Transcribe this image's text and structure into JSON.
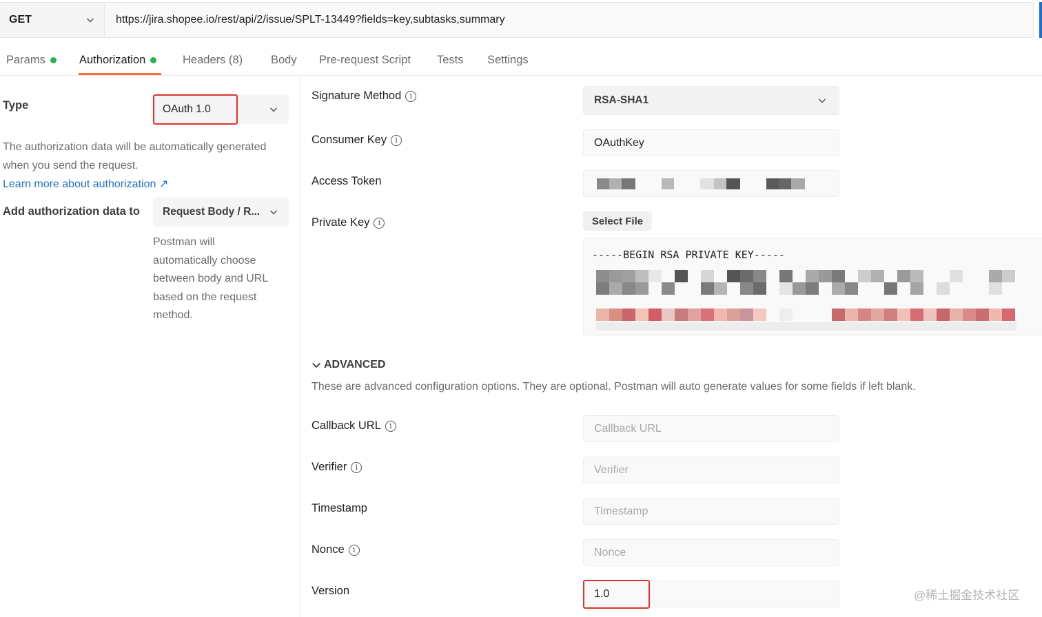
{
  "request": {
    "method": "GET",
    "url": "https://jira.shopee.io/rest/api/2/issue/SPLT-13449?fields=key,subtasks,summary"
  },
  "tabs": [
    {
      "label": "Params",
      "dot": true
    },
    {
      "label": "Authorization",
      "dot": true,
      "active": true
    },
    {
      "label": "Headers (8)"
    },
    {
      "label": "Body"
    },
    {
      "label": "Pre-request Script"
    },
    {
      "label": "Tests"
    },
    {
      "label": "Settings"
    }
  ],
  "auth": {
    "type_label": "Type",
    "type_value": "OAuth 1.0",
    "description_line1": "The authorization data will be automatically generated",
    "description_line2": "when you send the request.",
    "learn_more": "Learn more about authorization ↗",
    "add_to_label": "Add authorization data to",
    "add_to_value": "Request Body / R...",
    "add_to_help": [
      "Postman will",
      "automatically choose",
      "between body and URL",
      "based on the request",
      "method."
    ]
  },
  "fields": {
    "signature_method": {
      "label": "Signature Method",
      "value": "RSA-SHA1"
    },
    "consumer_key": {
      "label": "Consumer Key",
      "value": "OAuthKey"
    },
    "access_token": {
      "label": "Access Token"
    },
    "private_key": {
      "label": "Private Key",
      "button": "Select File",
      "header": "-----BEGIN RSA PRIVATE KEY-----"
    }
  },
  "advanced": {
    "title": "ADVANCED",
    "description": "These are advanced configuration options. They are optional. Postman will auto generate values for some fields if left blank.",
    "callback_url": {
      "label": "Callback URL",
      "placeholder": "Callback URL"
    },
    "verifier": {
      "label": "Verifier",
      "placeholder": "Verifier"
    },
    "timestamp": {
      "label": "Timestamp",
      "placeholder": "Timestamp"
    },
    "nonce": {
      "label": "Nonce",
      "placeholder": "Nonce"
    },
    "version": {
      "label": "Version",
      "value": "1.0"
    }
  },
  "watermark": "@稀土掘金技术社区",
  "icons": {
    "info": "info-icon",
    "chevron": "chevron-down-icon",
    "external": "external-link-icon"
  },
  "colors": {
    "accent": "#ff6c37",
    "link": "#1f6fd0",
    "dot": "#2bb24c",
    "highlight": "#e0322d"
  }
}
